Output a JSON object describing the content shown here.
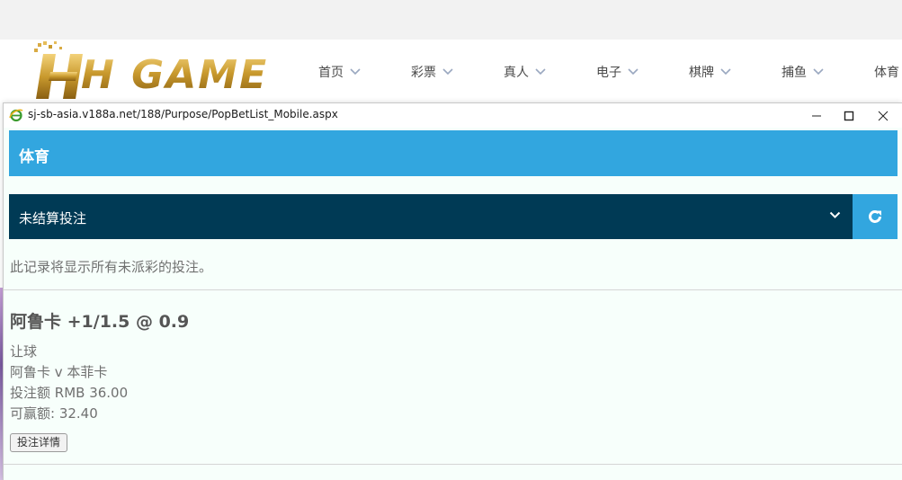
{
  "site": {
    "logo_text": "H GAME",
    "nav": [
      {
        "label": "首页"
      },
      {
        "label": "彩票"
      },
      {
        "label": "真人"
      },
      {
        "label": "电子"
      },
      {
        "label": "棋牌"
      },
      {
        "label": "捕鱼"
      },
      {
        "label": "体育"
      }
    ]
  },
  "popup": {
    "url": "sj-sb-asia.v188a.net/188/Purpose/PopBetList_Mobile.aspx",
    "header_title": "体育",
    "select_value": "未结算投注",
    "info_text": "此记录将显示所有未派彩的投注。",
    "bet": {
      "title": "阿鲁卡 +1/1.5 @ 0.9",
      "type": "让球",
      "match": "阿鲁卡 v 本菲卡",
      "stake": "投注额 RMB 36.00",
      "win": "可赢额: 32.40",
      "detail_button": "投注详情"
    }
  },
  "colors": {
    "header_blue": "#32a6df",
    "select_navy": "#003a55",
    "content_bg": "#f7fffb"
  },
  "icons": [
    "ie-icon",
    "minimize-icon",
    "maximize-icon",
    "close-icon",
    "chevron-down-icon",
    "refresh-icon"
  ]
}
